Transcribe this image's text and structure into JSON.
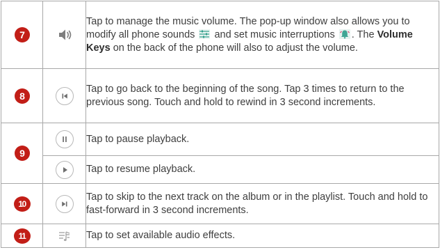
{
  "rows": [
    {
      "number": "7",
      "icon": "volume-icon",
      "desc": {
        "part1": "Tap to manage the music volume. The pop-up window also allows you to modify all phone sounds",
        "part2": "and set music interruptions",
        "part3": ". The",
        "bold": "Volume Keys",
        "part4": "on the back of the phone will also to adjust the volume."
      }
    },
    {
      "number": "8",
      "icon": "previous-track-icon",
      "desc": "Tap to go back to the beginning of the song. Tap 3 times to return to the previous song. Touch and hold to rewind in 3 second increments."
    },
    {
      "number": "9",
      "items": [
        {
          "icon": "pause-icon",
          "desc": "Tap to pause playback."
        },
        {
          "icon": "play-icon",
          "desc": "Tap to resume playback."
        }
      ]
    },
    {
      "number": "10",
      "icon": "next-track-icon",
      "desc": "Tap to skip to the next track on the album or in the playlist. Touch and hold to fast-forward in 3 second increments."
    },
    {
      "number": "11",
      "icon": "audio-effects-icon",
      "desc": "Tap to set available audio effects."
    }
  ],
  "colors": {
    "badge": "#c21e17",
    "icon_gray": "#8a8a8a",
    "border": "#a8a8a8",
    "sound_icon_accent": "#2e9e8a"
  }
}
